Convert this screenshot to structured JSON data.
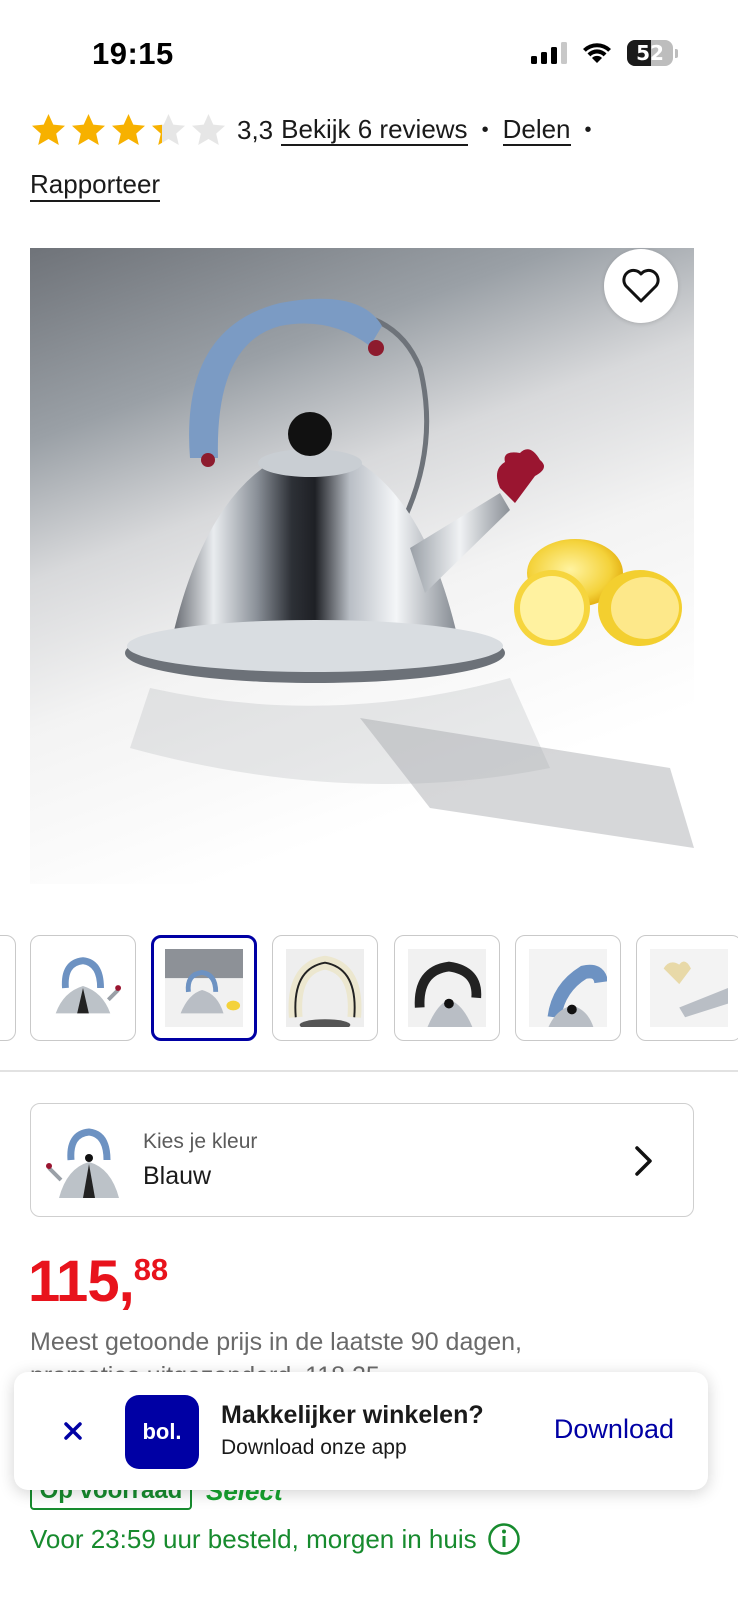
{
  "status_bar": {
    "time": "19:15",
    "battery": "52",
    "battery_fraction": 0.52,
    "icons": [
      "signal-icon",
      "wifi-icon",
      "battery-icon"
    ]
  },
  "rating": {
    "stars_filled": 3.3,
    "stars_total": 5,
    "value": "3,3",
    "reviews_link": "Bekijk 6 reviews",
    "separator": "•",
    "share_link": "Delen",
    "report_link": "Rapporteer"
  },
  "hero": {
    "favorite_icon": "heart-icon"
  },
  "thumbnails": {
    "count_visible": 7,
    "selected_index": 2
  },
  "color_selector": {
    "label": "Kies je kleur",
    "value": "Blauw",
    "chevron_icon": "chevron-right-icon"
  },
  "price": {
    "main": "115,",
    "cents": "88",
    "note_line_1": "Meest getoonde prijs in de laatste 90 dagen,",
    "note_line_2": "promoties uitgezonderd, 118,25"
  },
  "stock": {
    "badge": "Op voorraad",
    "select": "Select",
    "delivery": "Voor 23:59 uur besteld, morgen in huis"
  },
  "app_banner": {
    "close_icon": "close-icon",
    "logo_text": "bol.",
    "title": "Makkelijker winkelen?",
    "subtitle": "Download onze app",
    "cta": "Download"
  },
  "colors": {
    "brand_blue": "#0000a4",
    "price_red": "#e8131c",
    "stock_green": "#178b2e",
    "star_yellow": "#f7b100"
  }
}
